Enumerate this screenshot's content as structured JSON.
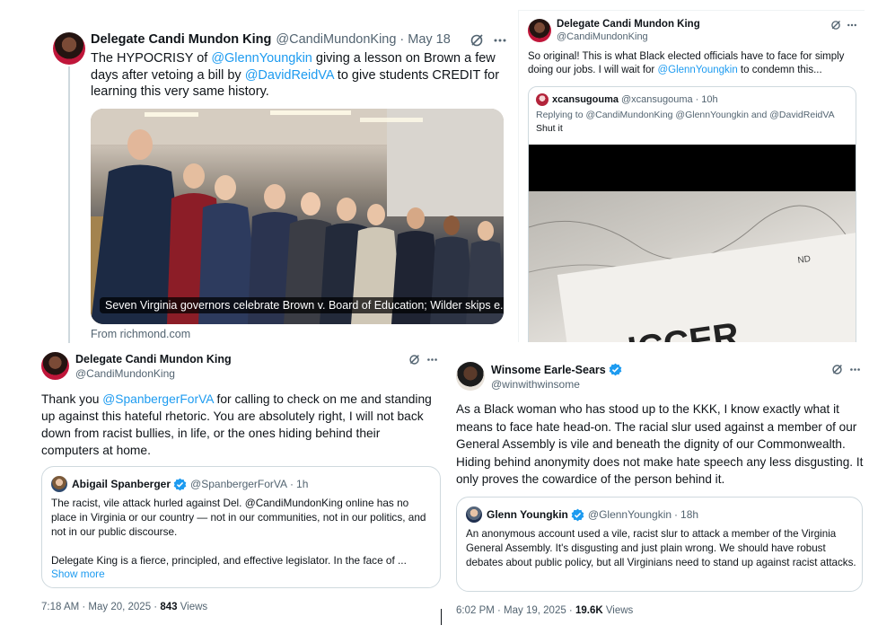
{
  "tweet1": {
    "author": "Delegate Candi Mundon King",
    "handle": "@CandiMundonKing",
    "dot": "·",
    "date": "May 18",
    "text_a": "The HYPOCRISY of ",
    "mention_a": "@GlennYoungkin",
    "text_b": " giving a lesson on Brown a few days after vetoing a bill by ",
    "mention_b": "@DavidReidVA",
    "text_c": " to give students CREDIT for learning this very same history.",
    "card_caption": "Seven Virginia governors celebrate Brown v. Board of Education; Wilder skips e...",
    "card_source": "From richmond.com"
  },
  "tweet2": {
    "author": "Delegate Candi Mundon King",
    "handle": "@CandiMundonKing",
    "text_a": "So original! This is what Black elected officials have to face for simply doing our jobs. I will wait for ",
    "mention": "@GlennYoungkin",
    "text_b": " to condemn this...",
    "quote": {
      "author": "xcansugouma",
      "handle": "@xcansugouma",
      "dot": "·",
      "time": "10h",
      "replying": "Replying to @CandiMundonKing @GlennYoungkin and @DavidReidVA",
      "text": "Shut it"
    }
  },
  "tweet3": {
    "author": "Delegate Candi Mundon King",
    "handle": "@CandiMundonKing",
    "text_a": "Thank you ",
    "mention": "@SpanbergerForVA",
    "text_b": " for calling to check on me and standing up against this hateful rhetoric. You are absolutely right, I will not back down from racist bullies, in life, or the ones hiding behind their computers at home.",
    "quote": {
      "author": "Abigail Spanberger",
      "handle": "@SpanbergerForVA",
      "dot": "·",
      "time": "1h",
      "p1": "The racist, vile attack hurled against Del. @CandiMundonKing online has no place in Virginia or our country — not in our communities, not in our politics, and not in our public discourse.",
      "p2": "Delegate King is a fierce, principled, and effective legislator. In the face of ...",
      "show_more": "Show more"
    },
    "meta_time": "7:18 AM · May 20, 2025 · ",
    "views_count": "843",
    "views_label": " Views"
  },
  "tweet4": {
    "author": "Winsome Earle-Sears",
    "handle": "@winwithwinsome",
    "text": "As a Black woman who has stood up to the KKK, I know exactly what it means to face hate head-on. The racial slur used against a member of our General Assembly is vile and beneath the dignity of our Commonwealth. Hiding behind anonymity does not make hate speech any less disgusting. It only proves the cowardice of the person behind it.",
    "quote": {
      "author": "Glenn Youngkin",
      "handle": "@GlennYoungkin",
      "dot": "·",
      "time": "18h",
      "text": "An anonymous account used a vile, racist slur to attack a member of the Virginia General Assembly. It's disgusting and just plain wrong. We should have robust debates about public policy, but all Virginians need to stand up against racist attacks."
    },
    "meta_time": "6:02 PM · May 19, 2025 · ",
    "views_count": "19.6K",
    "views_label": " Views"
  },
  "icons": {
    "grok": "grok-icon",
    "more": "more-icon",
    "verified": "verified-badge-icon"
  },
  "colors": {
    "link": "#1d9bf0",
    "muted": "#536471",
    "text": "#0f1419",
    "verified": "#1d9bf0"
  }
}
